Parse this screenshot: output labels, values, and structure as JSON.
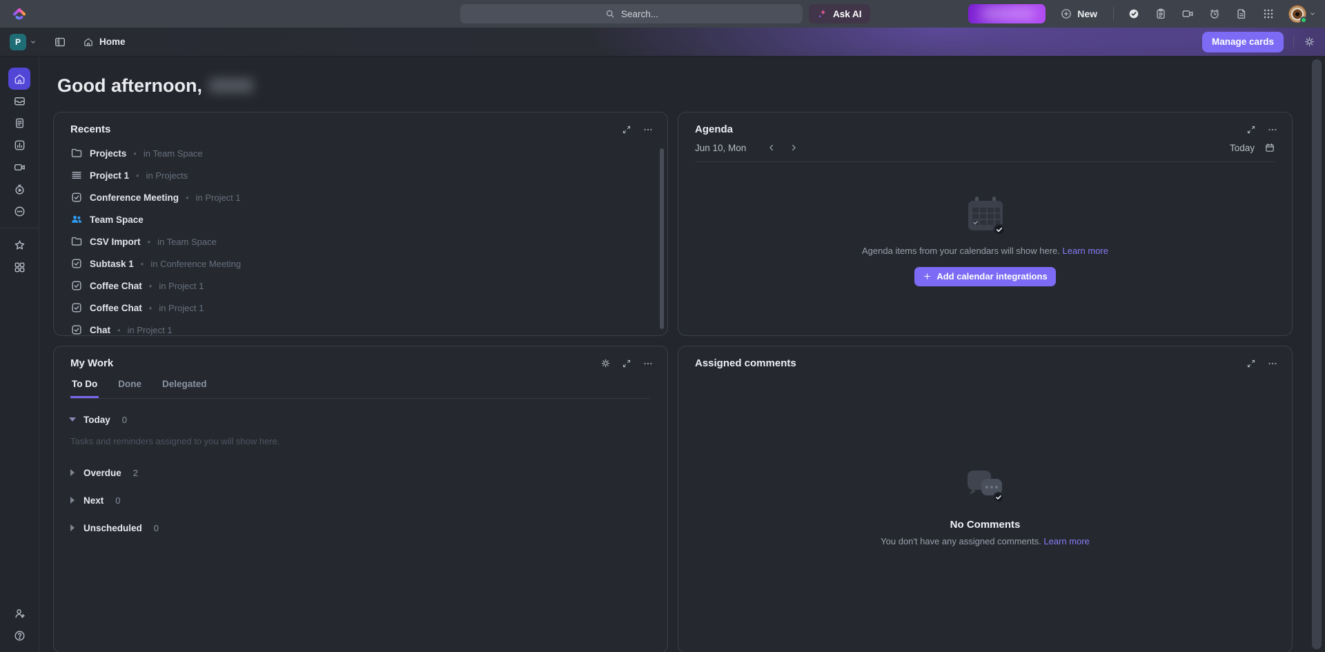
{
  "colors": {
    "accent": "#7b68ee",
    "accent-button": "#7d6bf5",
    "link": "#8a7cf8",
    "workspace-teal": "#1f6e76",
    "people-blue": "#2f9df5",
    "online-green": "#2ecc71"
  },
  "topbar": {
    "search_placeholder": "Search...",
    "ask_ai": "Ask AI",
    "new": "New"
  },
  "subheader": {
    "workspace_initial": "P",
    "page_title": "Home",
    "manage_cards": "Manage cards"
  },
  "greeting": "Good afternoon,",
  "recents": {
    "title": "Recents",
    "items": [
      {
        "icon": "folder",
        "name": "Projects",
        "dot": "•",
        "location": "in Team Space"
      },
      {
        "icon": "list",
        "name": "Project 1",
        "dot": "•",
        "location": "in Projects"
      },
      {
        "icon": "task",
        "name": "Conference Meeting",
        "dot": "•",
        "location": "in Project 1"
      },
      {
        "icon": "people",
        "name": "Team Space"
      },
      {
        "icon": "folder",
        "name": "CSV Import",
        "dot": "•",
        "location": "in Team Space"
      },
      {
        "icon": "task",
        "name": "Subtask 1",
        "dot": "•",
        "location": "in Conference Meeting"
      },
      {
        "icon": "task",
        "name": "Coffee Chat",
        "dot": "•",
        "location": "in Project 1"
      },
      {
        "icon": "task",
        "name": "Coffee Chat",
        "dot": "•",
        "location": "in Project 1"
      },
      {
        "icon": "task",
        "name": "Chat",
        "dot": "•",
        "location": "in Project 1"
      }
    ]
  },
  "agenda": {
    "title": "Agenda",
    "date_label": "Jun 10, Mon",
    "today": "Today",
    "empty_text": "Agenda items from your calendars will show here.",
    "learn_more": "Learn more",
    "add_button": "Add calendar integrations"
  },
  "my_work": {
    "title": "My Work",
    "tabs": [
      {
        "label": "To Do",
        "active": true
      },
      {
        "label": "Done"
      },
      {
        "label": "Delegated"
      }
    ],
    "sections": [
      {
        "label": "Today",
        "count": "0",
        "caret": "down",
        "empty_text": "Tasks and reminders assigned to you will show here."
      },
      {
        "label": "Overdue",
        "count": "2",
        "caret": "right"
      },
      {
        "label": "Next",
        "count": "0",
        "caret": "right"
      },
      {
        "label": "Unscheduled",
        "count": "0",
        "caret": "right"
      }
    ]
  },
  "assigned_comments": {
    "title": "Assigned comments",
    "empty_title": "No Comments",
    "empty_text": "You don't have any assigned comments.",
    "learn_more": "Learn more"
  }
}
